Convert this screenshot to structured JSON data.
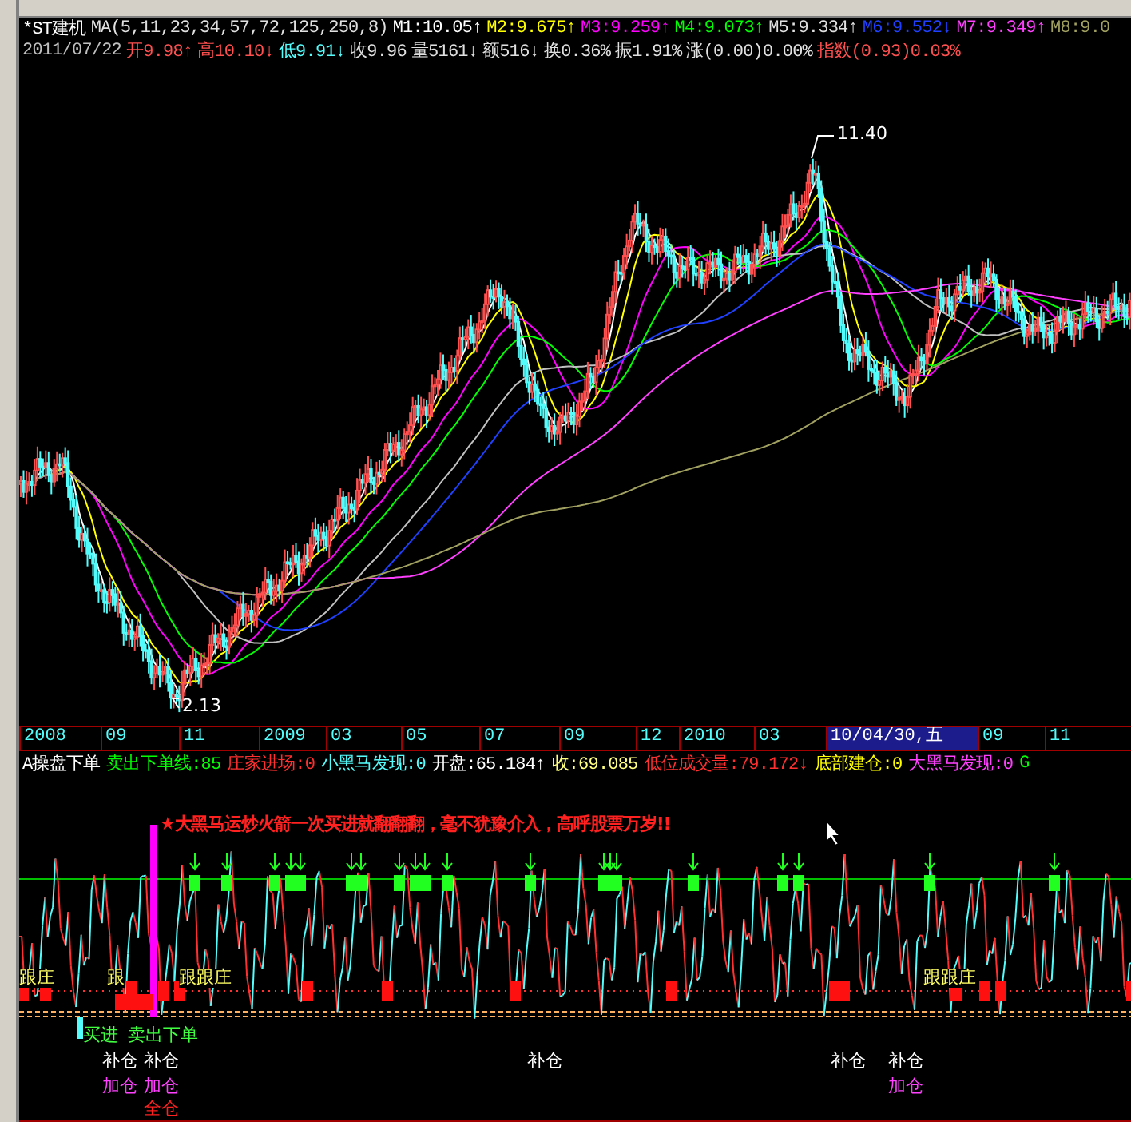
{
  "header": {
    "stock_name": "*ST建机",
    "ma_params": "MA(5,11,23,34,57,72,125,250,8)",
    "ma_values": [
      {
        "text": "M1:10.05↑",
        "color": "#ffffff"
      },
      {
        "text": "M2:9.675↑",
        "color": "#ffff00"
      },
      {
        "text": "M3:9.259↑",
        "color": "#ff00ff"
      },
      {
        "text": "M4:9.073↑",
        "color": "#00ff00"
      },
      {
        "text": "M5:9.334↑",
        "color": "#e0e0e0"
      },
      {
        "text": "M6:9.552↓",
        "color": "#2040ff"
      },
      {
        "text": "M7:9.349↑",
        "color": "#ff40ff"
      },
      {
        "text": "M8:9.0",
        "color": "#a0a060"
      }
    ]
  },
  "quote": [
    {
      "text": "2011/07/22",
      "color": "#c0c0c0"
    },
    {
      "text": "开9.98↑",
      "color": "#ff5050"
    },
    {
      "text": "高10.10↓",
      "color": "#ff5050"
    },
    {
      "text": "低9.91↓",
      "color": "#54fcfc"
    },
    {
      "text": "收9.96",
      "color": "#e0e0e0"
    },
    {
      "text": "量5161↓",
      "color": "#e0e0e0"
    },
    {
      "text": "额516↓",
      "color": "#e0e0e0"
    },
    {
      "text": "换0.36%",
      "color": "#e0e0e0"
    },
    {
      "text": "振1.91%",
      "color": "#e0e0e0"
    },
    {
      "text": "涨(0.00)0.00%",
      "color": "#e0e0e0"
    },
    {
      "text": "指数(0.93)0.03%",
      "color": "#ff5050"
    }
  ],
  "main_chart": {
    "annotations": [
      "11.40",
      "2.13"
    ]
  },
  "time_axis": [
    {
      "label": "2008",
      "selected": false
    },
    {
      "label": "09",
      "selected": false
    },
    {
      "label": "11",
      "selected": false
    },
    {
      "label": "2009",
      "selected": false
    },
    {
      "label": "03",
      "selected": false
    },
    {
      "label": "05",
      "selected": false
    },
    {
      "label": "07",
      "selected": false
    },
    {
      "label": "09",
      "selected": false
    },
    {
      "label": "12",
      "selected": false
    },
    {
      "label": "2010",
      "selected": false
    },
    {
      "label": "03",
      "selected": false
    },
    {
      "label": "10/04/30,五",
      "selected": true
    },
    {
      "label": "09",
      "selected": false
    },
    {
      "label": "11",
      "selected": false
    }
  ],
  "indicator": [
    {
      "text": "A操盘下单",
      "color": "#ffffff"
    },
    {
      "text": "卖出下单线:85",
      "color": "#00ff00"
    },
    {
      "text": "庄家进场:0",
      "color": "#ff3030"
    },
    {
      "text": "小黑马发现:0",
      "color": "#54fcfc"
    },
    {
      "text": "开盘:65.184↑",
      "color": "#ffffff"
    },
    {
      "text": "收:69.085",
      "color": "#ffff80"
    },
    {
      "text": "低位成交量:79.172↓",
      "color": "#ff3030"
    },
    {
      "text": "底部建仓:0",
      "color": "#ffff00"
    },
    {
      "text": "大黑马发现:0",
      "color": "#ff40ff"
    },
    {
      "text": "G",
      "color": "#00ff00"
    }
  ],
  "signals": {
    "banner": "★大黑马运炒火箭一次买进就翻翻翻，毫不犹豫介入，高呼股票万岁!!",
    "labels": [
      {
        "text": "跟庄",
        "color": "#ffff66"
      },
      {
        "text": "跟",
        "color": "#ffff66"
      },
      {
        "text": "跟跟庄",
        "color": "#ffff66"
      },
      {
        "text": "跟跟庄",
        "color": "#ffff66"
      },
      {
        "text": "买进",
        "color": "#40ff40"
      },
      {
        "text": "卖出下单",
        "color": "#40ff40"
      },
      {
        "text": "补仓",
        "color": "#ffffff"
      },
      {
        "text": "补仓",
        "color": "#ffffff"
      },
      {
        "text": "补仓",
        "color": "#ffffff"
      },
      {
        "text": "补仓",
        "color": "#ffffff"
      },
      {
        "text": "补仓",
        "color": "#ffffff"
      },
      {
        "text": "加仓",
        "color": "#ff40ff"
      },
      {
        "text": "加仓",
        "color": "#ff40ff"
      },
      {
        "text": "加仓",
        "color": "#ff40ff"
      },
      {
        "text": "全仓",
        "color": "#ff2020"
      }
    ]
  }
}
